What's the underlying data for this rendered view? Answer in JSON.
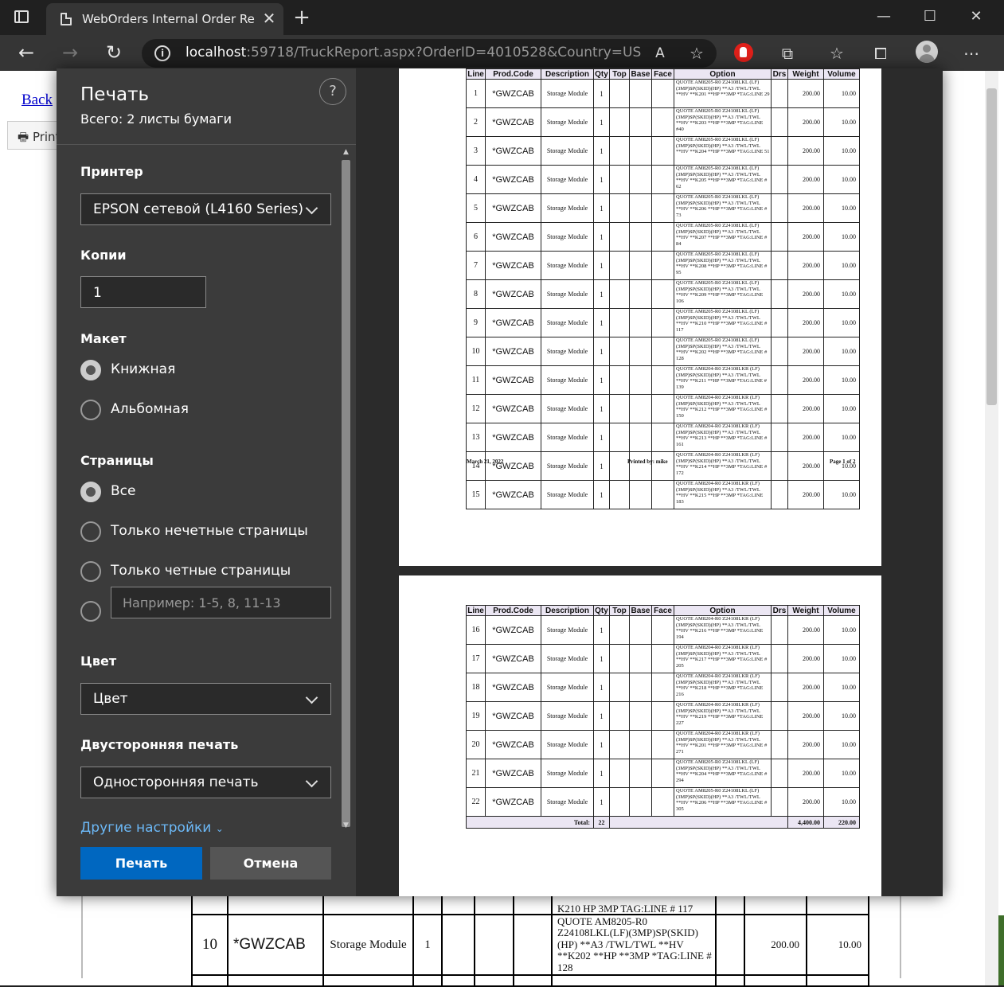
{
  "browser": {
    "tab_title": "WebOrders Internal Order Repor",
    "new_tab": "+",
    "url_host": "localhost",
    "url_rest": ":59718/TruckReport.aspx?OrderID=4010528&Country=US"
  },
  "page": {
    "back_link": "Back",
    "print_button": "Print",
    "bg_row": {
      "line": "10",
      "code": "*GWZCAB",
      "desc": "Storage Module",
      "qty": "1",
      "option": "QUOTE AM8205-R0 Z24108LKL(LF)(3MP)SP(SKID) (HP)  **A3 /TWL/TWL **HV **K202  **HP **3MP *TAG:LINE # 128",
      "weight": "200.00",
      "volume": "10.00",
      "prev_option_tail": "K210   HP   3MP   TAG:LINE # 117"
    }
  },
  "print_dialog": {
    "title": "Печать",
    "subtitle": "Всего: 2 листы бумаги",
    "help": "?",
    "printer_label": "Принтер",
    "printer_value": "EPSON сетевой (L4160 Series)",
    "copies_label": "Копии",
    "copies_value": "1",
    "layout_label": "Макет",
    "layout_portrait": "Книжная",
    "layout_landscape": "Альбомная",
    "pages_label": "Страницы",
    "pages_all": "Все",
    "pages_odd": "Только нечетные страницы",
    "pages_even": "Только четные страницы",
    "pages_custom_placeholder": "Например: 1-5, 8, 11-13",
    "color_label": "Цвет",
    "color_value": "Цвет",
    "duplex_label": "Двусторонняя печать",
    "duplex_value": "Односторонняя печать",
    "more_settings": "Другие настройки",
    "print_button": "Печать",
    "cancel_button": "Отмена"
  },
  "preview": {
    "headers": [
      "Line",
      "Prod.Code",
      "Description",
      "Qty",
      "Top",
      "Base",
      "Face",
      "Option",
      "Drs",
      "Weight",
      "Volume"
    ],
    "page1_rows": [
      {
        "line": "1",
        "code": "*GWZCAB",
        "desc": "Storage Module",
        "qty": "1",
        "option": "QUOTE AM8205-R0 Z24108LKL (LF)(3MP)SP(SKID)(HP) **A3 /TWL/TWL **HV **K201 **HP **3MP *TAG:LINE 29",
        "weight": "200.00",
        "volume": "10.00"
      },
      {
        "line": "2",
        "code": "*GWZCAB",
        "desc": "Storage Module",
        "qty": "1",
        "option": "QUOTE AM8205-R0 Z24108LKL (LF)(3MP)SP(SKID)(HP)  **A3 /TWL/TWL **HV **K203 **HP **3MP  *TAG:LINE #40",
        "weight": "200.00",
        "volume": "10.00"
      },
      {
        "line": "3",
        "code": "*GWZCAB",
        "desc": "Storage Module",
        "qty": "1",
        "option": "QUOTE AM8205-R0 Z24108LKL (LF)(3MP)SP(SKID)(HP) **A3 /TWL/TWL **HV **K204 **HP **3MP  *TAG:LINE 51",
        "weight": "200.00",
        "volume": "10.00"
      },
      {
        "line": "4",
        "code": "*GWZCAB",
        "desc": "Storage Module",
        "qty": "1",
        "option": "QUOTE AM8205-R0 Z24108LKL (LF)(3MP)SP(SKID)(HP)  **A3 /TWL/TWL **HV **K205 **HP **3MP *TAG:LINE # 62",
        "weight": "200.00",
        "volume": "10.00"
      },
      {
        "line": "5",
        "code": "*GWZCAB",
        "desc": "Storage Module",
        "qty": "1",
        "option": "QUOTE AM8205-R0 Z24108LKL (LF)(3MP)SP(SKID)(HP) **A3 /TWL/TWL **HV **K206 **HP **3MP *TAG:LINE # 73",
        "weight": "200.00",
        "volume": "10.00"
      },
      {
        "line": "6",
        "code": "*GWZCAB",
        "desc": "Storage Module",
        "qty": "1",
        "option": "QUOTE AM8205-R0 Z24108LKL (LF)(3MP)SP(SKID)(HP) **A3 /TWL/TWL **HV **K207 **HP **3MP *TAG:LINE # 84",
        "weight": "200.00",
        "volume": "10.00"
      },
      {
        "line": "7",
        "code": "*GWZCAB",
        "desc": "Storage Module",
        "qty": "1",
        "option": "QUOTE AM8205-R0 Z24108LKL (LF)(3MP)SP(SKID)(HP) **A3 /TWL/TWL **HV **K208  **HP **3MP *TAG:LINE # 95",
        "weight": "200.00",
        "volume": "10.00"
      },
      {
        "line": "8",
        "code": "*GWZCAB",
        "desc": "Storage Module",
        "qty": "1",
        "option": "QUOTE AM8205-R0 Z24108LKL (LF)(3MP)SP(SKID)(HP) **A3 /TWL/TWL **HV **K209 **HP **3MP *TAG:LINE 106",
        "weight": "200.00",
        "volume": "10.00"
      },
      {
        "line": "9",
        "code": "*GWZCAB",
        "desc": "Storage Module",
        "qty": "1",
        "option": "QUOTE AM8205-R0 Z24108LKL (LF)(3MP)SP(SKID)(HP) **A3 /TWL/TWL **HV **K210  **HP **3MP *TAG:LINE # 117",
        "weight": "200.00",
        "volume": "10.00"
      },
      {
        "line": "10",
        "code": "*GWZCAB",
        "desc": "Storage Module",
        "qty": "1",
        "option": "QUOTE AM8205-R0 Z24108LKL (LF)(3MP)SP(SKID)(HP) **A3 /TWL/TWL **HV **K202  **HP **3MP *TAG:LINE # 128",
        "weight": "200.00",
        "volume": "10.00"
      },
      {
        "line": "11",
        "code": "*GWZCAB",
        "desc": "Storage Module",
        "qty": "1",
        "option": "QUOTE AM8204-R0 Z24108LKR (LF)(3MP)SP(SKID)(HP) **A3 /TWL/TWL **HV **K211 **HP **3MP *TAG:LINE # 139",
        "weight": "200.00",
        "volume": "10.00"
      },
      {
        "line": "12",
        "code": "*GWZCAB",
        "desc": "Storage Module",
        "qty": "1",
        "option": "QUOTE AM8204-R0 Z24108LKR (LF)(3MP)SP(SKID)(HP) **A3 /TWL/TWL **HV **K212  **HP **3MP *TAG:LINE # 150",
        "weight": "200.00",
        "volume": "10.00"
      },
      {
        "line": "13",
        "code": "*GWZCAB",
        "desc": "Storage Module",
        "qty": "1",
        "option": "QUOTE AM8204-R0 Z24108LKR (LF)(3MP)SP(SKID)(HP) **A3 /TWL/TWL **HV **K213  **HP **3MP  *TAG:LINE # 161",
        "weight": "200.00",
        "volume": "10.00"
      },
      {
        "line": "14",
        "code": "*GWZCAB",
        "desc": "Storage Module",
        "qty": "1",
        "option": "QUOTE AM8204-R0 Z24108LKR (LF)(3MP)SP(SKID)(HP) **A3 /TWL/TWL **HV **K214 **HP **3MP *TAG:LINE # 172",
        "weight": "200.00",
        "volume": "10.00"
      },
      {
        "line": "15",
        "code": "*GWZCAB",
        "desc": "Storage Module",
        "qty": "1",
        "option": "QUOTE AM8204-R0 Z24108LKR (LF)(3MP)SP(SKID)(HP) **A3 /TWL/TWL **HV **K215  **HP **3MP  *TAG:LINE 183",
        "weight": "200.00",
        "volume": "10.00"
      }
    ],
    "page1_footer": {
      "date": "March 21, 2022",
      "printed_by": "Printed by: mike",
      "page": "Page 1 of 2"
    },
    "page2_rows": [
      {
        "line": "16",
        "code": "*GWZCAB",
        "desc": "Storage Module",
        "qty": "1",
        "option": "QUOTE AM8204-R0 Z24108LKR (LF)(3MP)SP(SKID)(HP) **A3 /TWL/TWL **HV **K216  **HP **3MP *TAG:LINE 194",
        "weight": "200.00",
        "volume": "10.00"
      },
      {
        "line": "17",
        "code": "*GWZCAB",
        "desc": "Storage Module",
        "qty": "1",
        "option": "QUOTE AM8204-R0 Z24108LKR (LF)(3MP)SP(SKID)(HP)  **A3 /TWL/TWL **HV **K217  **HP **3MP *TAG:LINE # 205",
        "weight": "200.00",
        "volume": "10.00"
      },
      {
        "line": "18",
        "code": "*GWZCAB",
        "desc": "Storage Module",
        "qty": "1",
        "option": "QUOTE AM8204-R0 Z24108LKR (LF)(3MP)SP(SKID)(HP) **A3 /TWL/TWL **HV **K218  **HP **3MP *TAG:LINE 216",
        "weight": "200.00",
        "volume": "10.00"
      },
      {
        "line": "19",
        "code": "*GWZCAB",
        "desc": "Storage Module",
        "qty": "1",
        "option": "QUOTE AM8204-R0 Z24108LKR (LF)(3MP)SP(SKID)(HP) **A3 /TWL/TWL **HV **K219  **HP **3MP *TAG:LINE 227",
        "weight": "200.00",
        "volume": "10.00"
      },
      {
        "line": "20",
        "code": "*GWZCAB",
        "desc": "Storage Module",
        "qty": "1",
        "option": "QUOTE AM8204-R0 Z24108LKR (LF)(3MP)SP(SKID)(HP) **A3 /TWL/TWL **HV **K201  **HP **3MP  *TAG:LINE # 271",
        "weight": "200.00",
        "volume": "10.00"
      },
      {
        "line": "21",
        "code": "*GWZCAB",
        "desc": "Storage Module",
        "qty": "1",
        "option": "QUOTE AM8205-R0 Z24108LKL (LF)(3MP)SP(SKID)(HP) **A3 /TWL/TWL **HV **K204 **HP **3MP *TAG:LINE # 294",
        "weight": "200.00",
        "volume": "10.00"
      },
      {
        "line": "22",
        "code": "*GWZCAB",
        "desc": "Storage Module",
        "qty": "1",
        "option": "QUOTE AM8205-R0 Z24108LKL (LF)(3MP)SP(SKID)(HP) **A3 /TWL/TWL **HV **K206 **HP **3MP  *TAG:LINE # 305",
        "weight": "200.00",
        "volume": "10.00"
      }
    ],
    "total": {
      "label": "Total:",
      "qty": "22",
      "weight": "4,400.00",
      "volume": "220.00"
    }
  }
}
